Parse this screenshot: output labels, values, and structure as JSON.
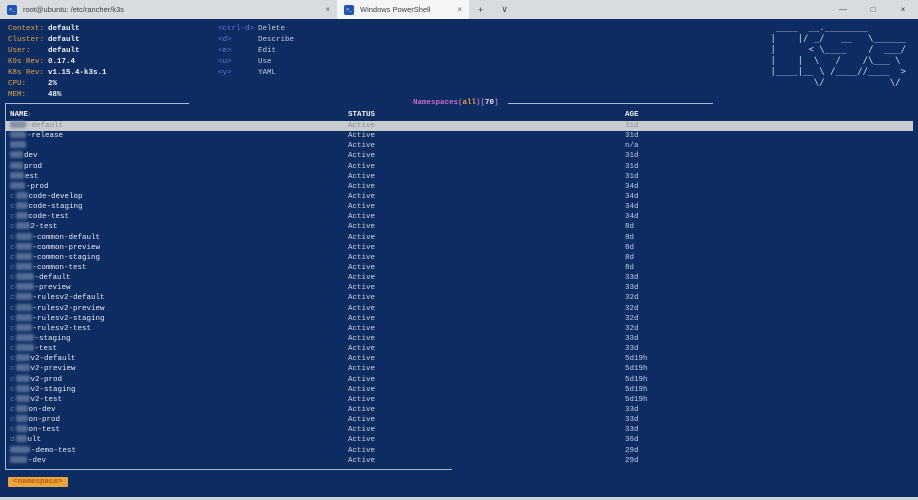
{
  "window": {
    "tabs": [
      {
        "label": "root@ubuntu: /etc/rancher/k3s",
        "active": false
      },
      {
        "label": "Windows PowerShell",
        "active": true
      }
    ],
    "icons": {
      "terminal": ">_",
      "tab_close": "×",
      "new_tab": "+",
      "tab_dropdown": "∨",
      "minimize": "—",
      "maximize": "□",
      "close": "×",
      "sort_asc": "↑"
    }
  },
  "k9s": {
    "info": [
      {
        "label": "Context:",
        "value": "default"
      },
      {
        "label": "Cluster:",
        "value": "default"
      },
      {
        "label": "User:",
        "value": "default"
      },
      {
        "label": "K9s Rev:",
        "value": "0.17.4"
      },
      {
        "label": "K8s Rev:",
        "value": "v1.15.4-k3s.1"
      },
      {
        "label": "CPU:",
        "value": "2%"
      },
      {
        "label": "MEM:",
        "value": "48%"
      }
    ],
    "keybindings": [
      {
        "key": "<ctrl-d>",
        "action": "Delete"
      },
      {
        "key": "<d>",
        "action": "Describe"
      },
      {
        "key": "<e>",
        "action": "Edit"
      },
      {
        "key": "<u>",
        "action": "Use"
      },
      {
        "key": "<y>",
        "action": "YAML"
      }
    ],
    "logo_lines": [
      " ____  __.________       ",
      "|    |/ _/   __   \\______",
      "|      < \\____    /  ___/",
      "|    |  \\   /    /\\___ \\ ",
      "|____|__ \\ /____//____  >",
      "        \\/            \\/ "
    ]
  },
  "table": {
    "title": {
      "prefix": "Namespaces(",
      "scope": "all",
      "mid": ")[",
      "count": "70",
      "suffix": "]"
    },
    "columns": [
      "NAME",
      "STATUS",
      "AGE"
    ],
    "rows": [
      {
        "lead": "",
        "blur": 16,
        "name": "-default",
        "status": "Active",
        "age": "31d",
        "selected": true
      },
      {
        "lead": "",
        "blur": 16,
        "name": "-release",
        "status": "Active",
        "age": "31d"
      },
      {
        "lead": "",
        "blur": 16,
        "name": "",
        "status": "Active",
        "age": "n/a"
      },
      {
        "lead": "",
        "blur": 13,
        "name": "dev",
        "status": "Active",
        "age": "31d"
      },
      {
        "lead": "",
        "blur": 13,
        "name": "prod",
        "status": "Active",
        "age": "31d"
      },
      {
        "lead": "",
        "blur": 14,
        "name": "est",
        "status": "Active",
        "age": "31d"
      },
      {
        "lead": "",
        "blur": 15,
        "name": "-prod",
        "status": "Active",
        "age": "34d"
      },
      {
        "lead": "c",
        "blur": 12,
        "name": "code-develop",
        "status": "Active",
        "age": "34d"
      },
      {
        "lead": "c",
        "blur": 12,
        "name": "code-staging",
        "status": "Active",
        "age": "34d"
      },
      {
        "lead": "c",
        "blur": 12,
        "name": "code-test",
        "status": "Active",
        "age": "34d"
      },
      {
        "lead": "c",
        "blur": 14,
        "name": "2-test",
        "status": "Active",
        "age": "8d"
      },
      {
        "lead": "c",
        "blur": 16,
        "name": "-common-default",
        "status": "Active",
        "age": "8d"
      },
      {
        "lead": "c",
        "blur": 16,
        "name": "-common-preview",
        "status": "Active",
        "age": "8d"
      },
      {
        "lead": "c",
        "blur": 16,
        "name": "-common-staging",
        "status": "Active",
        "age": "8d"
      },
      {
        "lead": "c",
        "blur": 16,
        "name": "-common-test",
        "status": "Active",
        "age": "8d"
      },
      {
        "lead": "c",
        "blur": 18,
        "name": "-default",
        "status": "Active",
        "age": "33d"
      },
      {
        "lead": "c",
        "blur": 18,
        "name": "-preview",
        "status": "Active",
        "age": "33d"
      },
      {
        "lead": "c",
        "blur": 16,
        "name": "-rulesv2-default",
        "status": "Active",
        "age": "32d"
      },
      {
        "lead": "c",
        "blur": 16,
        "name": "-rulesv2-preview",
        "status": "Active",
        "age": "32d"
      },
      {
        "lead": "c",
        "blur": 16,
        "name": "-rulesv2-staging",
        "status": "Active",
        "age": "32d"
      },
      {
        "lead": "c",
        "blur": 16,
        "name": "-rulesv2-test",
        "status": "Active",
        "age": "32d"
      },
      {
        "lead": "c",
        "blur": 18,
        "name": "-staging",
        "status": "Active",
        "age": "33d"
      },
      {
        "lead": "c",
        "blur": 18,
        "name": "-test",
        "status": "Active",
        "age": "33d"
      },
      {
        "lead": "c",
        "blur": 14,
        "name": "v2-default",
        "status": "Active",
        "age": "5d19h"
      },
      {
        "lead": "c",
        "blur": 14,
        "name": "v2-preview",
        "status": "Active",
        "age": "5d19h"
      },
      {
        "lead": "c",
        "blur": 14,
        "name": "v2-prod",
        "status": "Active",
        "age": "5d19h"
      },
      {
        "lead": "c",
        "blur": 14,
        "name": "v2-staging",
        "status": "Active",
        "age": "5d19h"
      },
      {
        "lead": "c",
        "blur": 14,
        "name": "v2-test",
        "status": "Active",
        "age": "5d19h"
      },
      {
        "lead": "c",
        "blur": 12,
        "name": "on-dev",
        "status": "Active",
        "age": "33d"
      },
      {
        "lead": "c",
        "blur": 12,
        "name": "on-prod",
        "status": "Active",
        "age": "33d"
      },
      {
        "lead": "c",
        "blur": 12,
        "name": "on-test",
        "status": "Active",
        "age": "33d"
      },
      {
        "lead": "d",
        "blur": 11,
        "name": "ult",
        "status": "Active",
        "age": "36d"
      },
      {
        "lead": "",
        "blur": 20,
        "name": "-demo-test",
        "status": "Active",
        "age": "29d"
      },
      {
        "lead": "",
        "blur": 17,
        "name": "-dev",
        "status": "Active",
        "age": "29d"
      }
    ]
  },
  "crumb": {
    "label": "<namespace>"
  },
  "colors": {
    "terminal_bg": "#0d2d62",
    "label_orange": "#e9a23c",
    "key_blue": "#5b79dd",
    "title_purple": "#c46ac4",
    "border": "#a9bad8",
    "selection_bg": "#c8cbcf",
    "crumb_bg": "#eca43e",
    "crumb_text": "#b35a10",
    "tabbar_bg": "#d9dcdf",
    "active_tab_bg": "#f4f5f6"
  }
}
